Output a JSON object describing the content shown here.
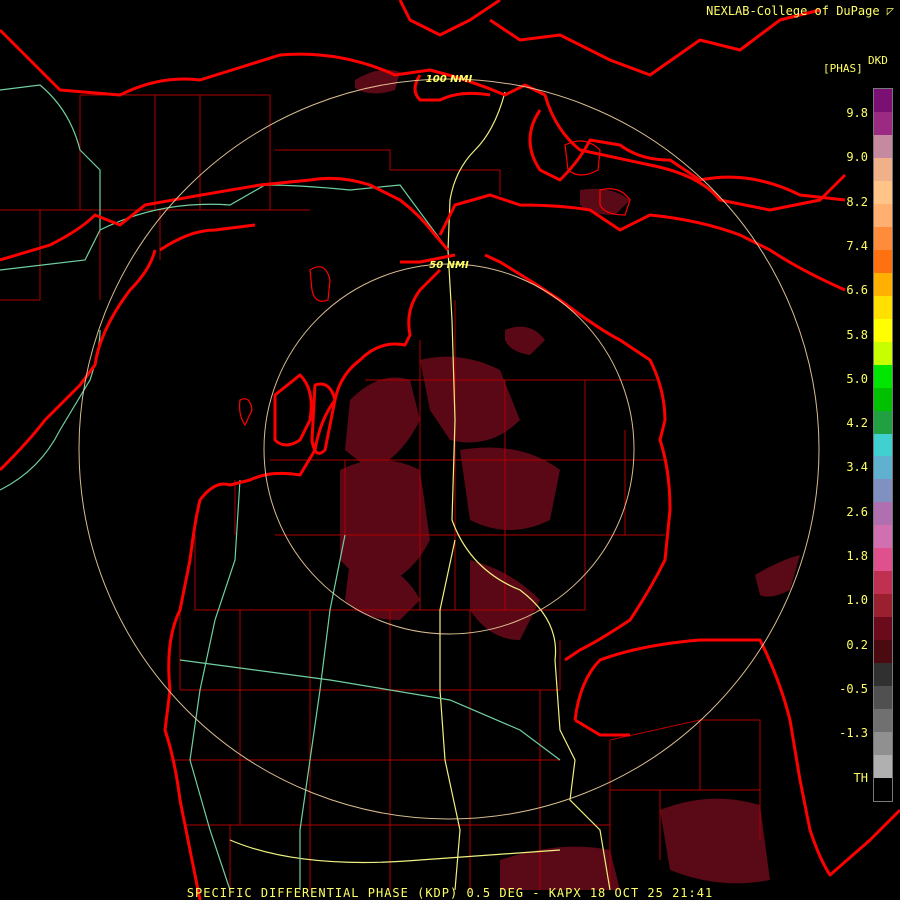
{
  "header": {
    "credit": "NEXLAB-College of DuPage",
    "product_code": "DKD",
    "unit": "[PHAS]"
  },
  "range_rings": {
    "inner_label": "50 NMI",
    "outer_label": "100 NMI"
  },
  "legend": {
    "ticks": [
      "9.8",
      "9.0",
      "8.2",
      "7.4",
      "6.6",
      "5.8",
      "5.0",
      "4.2",
      "3.4",
      "2.6",
      "1.8",
      "1.0",
      "0.2",
      "-0.5",
      "-1.3",
      "TH"
    ],
    "colors": [
      "#7a0f74",
      "#9b2a82",
      "#c58aa0",
      "#f0b08a",
      "#ffc488",
      "#ffb070",
      "#ff8c3a",
      "#ff7010",
      "#ffb000",
      "#ffe000",
      "#ffff00",
      "#c8ff00",
      "#00e600",
      "#00c000",
      "#20a040",
      "#40d0d0",
      "#60b0d0",
      "#8090c0",
      "#b070b0",
      "#d070b0",
      "#e0508c",
      "#c03050",
      "#9a2030",
      "#6a0a1a",
      "#4a0a10",
      "#303030",
      "#505050",
      "#707070",
      "#909090",
      "#b0b0b0",
      "#000000"
    ]
  },
  "colors": {
    "state_border": "#ff0000",
    "county": "#b00000",
    "road_primary": "#f0f080",
    "road_secondary": "#70d0a0",
    "range_ring": "#f0d0a0"
  },
  "footer": {
    "caption": "SPECIFIC DIFFERENTIAL PHASE (KDP) 0.5 DEG - KAPX 18 OCT 25 21:41"
  }
}
